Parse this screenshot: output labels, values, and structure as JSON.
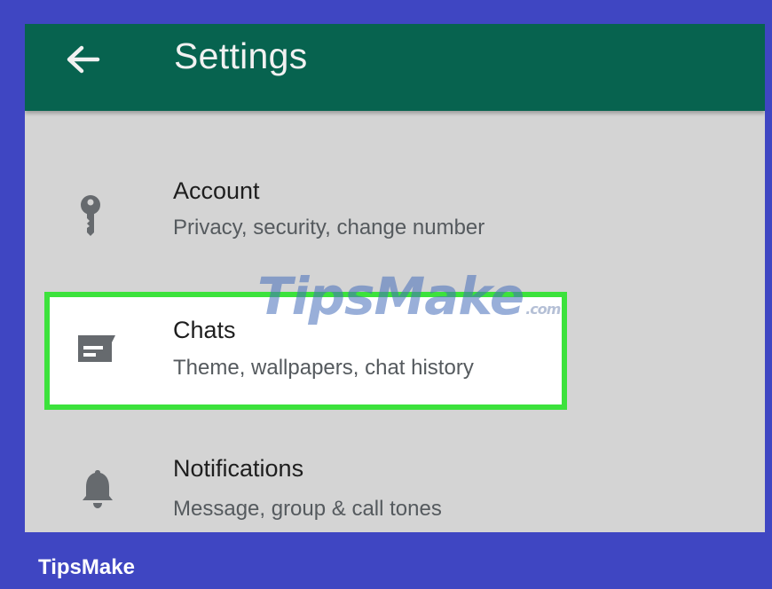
{
  "appbar": {
    "back_icon": "back-arrow-icon",
    "title": "Settings",
    "background": "#07634f"
  },
  "settings_items": [
    {
      "icon": "key-icon",
      "title": "Account",
      "subtitle": "Privacy, security, change number"
    },
    {
      "icon": "chat-icon",
      "title": "Chats",
      "subtitle": "Theme, wallpapers, chat history",
      "highlighted": true
    },
    {
      "icon": "bell-icon",
      "title": "Notifications",
      "subtitle": "Message, group & call tones"
    }
  ],
  "watermark": {
    "text": "TipsMake",
    "suffix": ".com"
  },
  "footer": {
    "brand": "TipsMake",
    "frame_color": "#3f46c2",
    "highlight_color": "#3ce23c"
  }
}
